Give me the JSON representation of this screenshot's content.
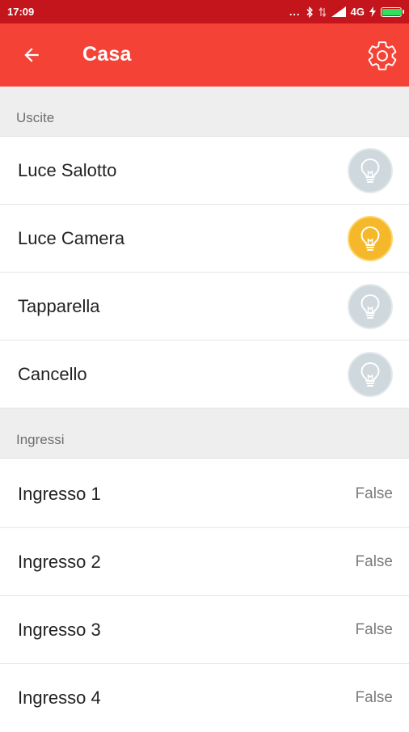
{
  "status_bar": {
    "time": "17:09",
    "dots": "...",
    "network": "4G",
    "bluetooth_icon": "bluetooth-icon",
    "signal_icon": "signal-icon",
    "battery_icon": "battery-charging-icon",
    "battery_color": "#2ee05a"
  },
  "app_bar": {
    "title": "Casa",
    "back_icon": "arrow-left-icon",
    "settings_icon": "gear-icon",
    "color": "#f44336"
  },
  "outputs": {
    "header": "Uscite",
    "items": [
      {
        "label": "Luce Salotto",
        "state": "off",
        "icon": "lightbulb-icon"
      },
      {
        "label": "Luce Camera",
        "state": "on",
        "icon": "lightbulb-icon"
      },
      {
        "label": "Tapparella",
        "state": "off",
        "icon": "lightbulb-icon"
      },
      {
        "label": "Cancello",
        "state": "off",
        "icon": "lightbulb-icon"
      }
    ]
  },
  "inputs": {
    "header": "Ingressi",
    "items": [
      {
        "label": "Ingresso 1",
        "value": "False"
      },
      {
        "label": "Ingresso 2",
        "value": "False"
      },
      {
        "label": "Ingresso 3",
        "value": "False"
      },
      {
        "label": "Ingresso 4",
        "value": "False"
      }
    ]
  },
  "colors": {
    "status_bar": "#c4151c",
    "bulb_on": "#f5b82a",
    "bulb_off": "#cfd8dc"
  }
}
